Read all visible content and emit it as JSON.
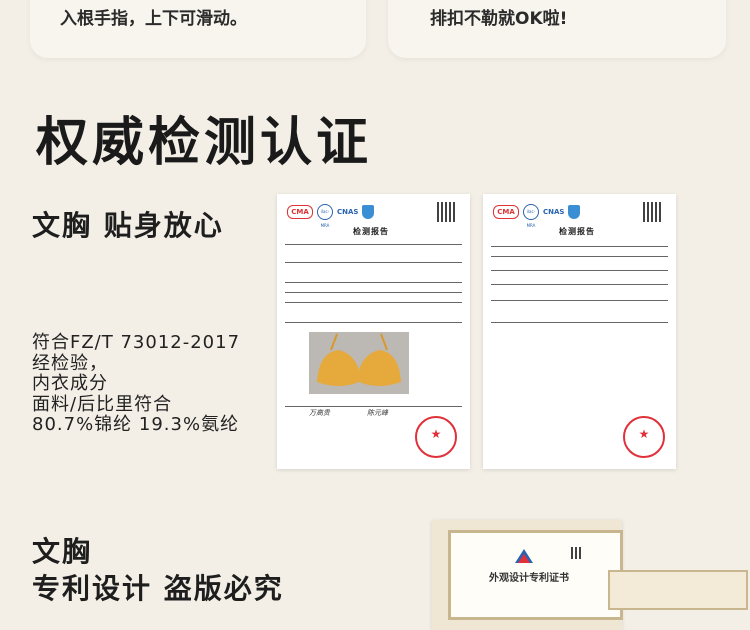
{
  "top_cards": {
    "left_text": "入根手指，上下可滑动。",
    "right_text": "排扣不勒就OK啦!"
  },
  "section_title": "权威检测认证",
  "inspection": {
    "heading": "文胸 贴身放心",
    "desc_lines": [
      "符合FZ/T 73012-2017",
      "经检验，",
      "内衣成分",
      "面料/后比里符合",
      "80.7%锦纶 19.3%氨纶"
    ]
  },
  "reports": {
    "title": "检测报告",
    "logo_ma": "CMA",
    "logo_cnas": "CNAS",
    "logo_ilac": "ilac-MRA"
  },
  "patent": {
    "heading_line1": "文胸",
    "heading_line2": "专利设计 盗版必究",
    "cert_title": "外观设计专利证书"
  },
  "colors": {
    "background": "#f3efe7",
    "stamp": "#e0303a",
    "garment": "#e6a93c"
  }
}
